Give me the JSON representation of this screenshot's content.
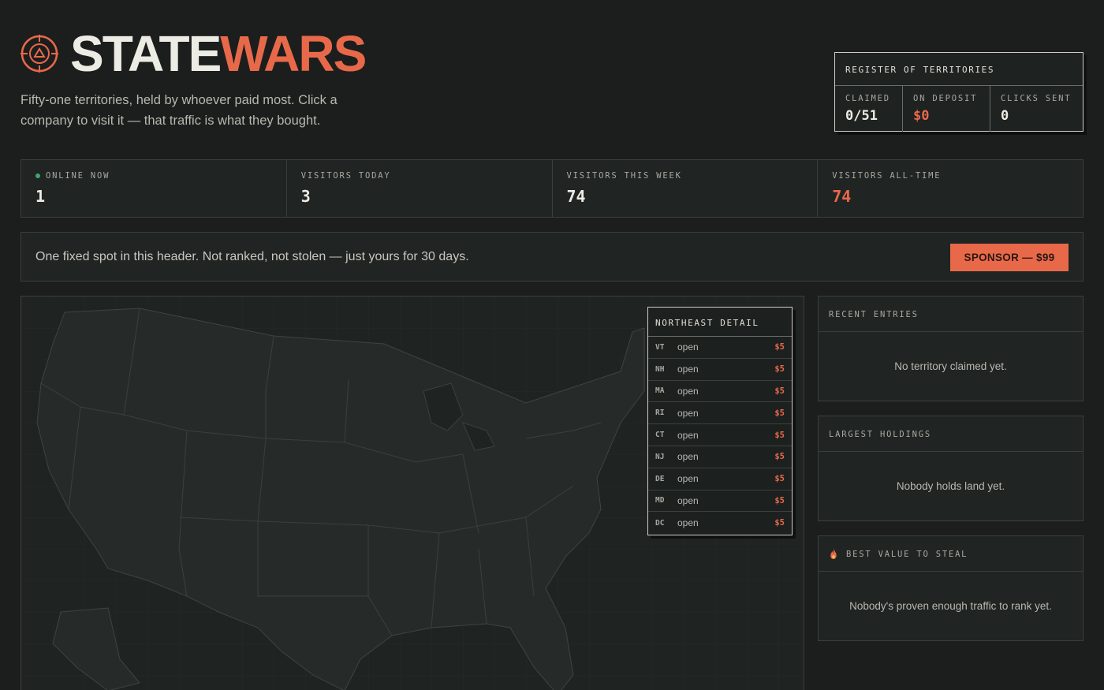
{
  "header": {
    "logo_icon": "crosshair-triangle-icon",
    "title_part1": "STATE",
    "title_part2": "WARS",
    "tagline": "Fifty-one territories, held by whoever paid most. Click a company to visit it — that traffic is what they bought."
  },
  "register": {
    "title": "REGISTER OF TERRITORIES",
    "claimed_label": "CLAIMED",
    "claimed_value": "0/51",
    "deposit_label": "ON DEPOSIT",
    "deposit_value": "$0",
    "clicks_label": "CLICKS SENT",
    "clicks_value": "0"
  },
  "stats": [
    {
      "label": "ONLINE NOW",
      "value": "1"
    },
    {
      "label": "VISITORS TODAY",
      "value": "3"
    },
    {
      "label": "VISITORS THIS WEEK",
      "value": "74"
    },
    {
      "label": "VISITORS ALL-TIME",
      "value": "74"
    }
  ],
  "sponsor": {
    "text": "One fixed spot in this header. Not ranked, not stolen — just yours for 30 days.",
    "button": "SPONSOR — $99"
  },
  "northeast": {
    "title": "NORTHEAST DETAIL",
    "rows": [
      {
        "code": "VT",
        "status": "open",
        "price": "$5"
      },
      {
        "code": "NH",
        "status": "open",
        "price": "$5"
      },
      {
        "code": "MA",
        "status": "open",
        "price": "$5"
      },
      {
        "code": "RI",
        "status": "open",
        "price": "$5"
      },
      {
        "code": "CT",
        "status": "open",
        "price": "$5"
      },
      {
        "code": "NJ",
        "status": "open",
        "price": "$5"
      },
      {
        "code": "DE",
        "status": "open",
        "price": "$5"
      },
      {
        "code": "MD",
        "status": "open",
        "price": "$5"
      },
      {
        "code": "DC",
        "status": "open",
        "price": "$5"
      }
    ]
  },
  "panels": {
    "recent_title": "RECENT ENTRIES",
    "recent_empty": "No territory claimed yet.",
    "largest_title": "LARGEST HOLDINGS",
    "largest_empty": "Nobody holds land yet.",
    "steal_icon": "fire-icon",
    "steal_title": "BEST VALUE TO STEAL",
    "steal_empty": "Nobody's proven enough traffic to rank yet."
  },
  "colors": {
    "accent": "#e8694a",
    "background": "#1b1e1d",
    "online_dot": "#3fa56a"
  }
}
